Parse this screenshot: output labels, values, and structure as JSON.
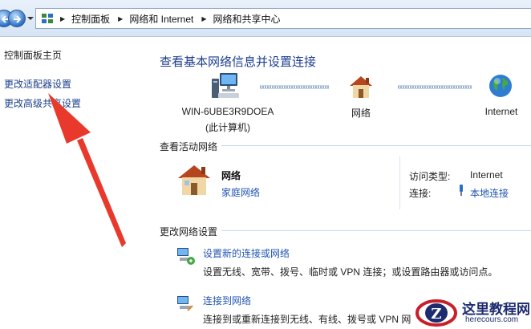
{
  "address_bar": {
    "crumbs": [
      "控制面板",
      "网络和 Internet",
      "网络和共享中心"
    ]
  },
  "left_pane": {
    "home_link": "控制面板主页",
    "adapter_link": "更改适配器设置",
    "advanced_link": "更改高级共享设置"
  },
  "main": {
    "title": "查看基本网络信息并设置连接",
    "map": {
      "computer_name": "WIN-6UBE3R9DOEA",
      "computer_sub": "(此计算机)",
      "network_label": "网络",
      "internet_label": "Internet"
    },
    "active_section": {
      "heading": "查看活动网络",
      "network_name": "网络",
      "network_type": "家庭网络",
      "access_type_label": "访问类型:",
      "access_type_value": "Internet",
      "connection_label": "连接:",
      "connection_value": "本地连接"
    },
    "change_section": {
      "heading": "更改网络设置",
      "tasks": [
        {
          "link": "设置新的连接或网络",
          "desc": "设置无线、宽带、拨号、临时或 VPN 连接；或设置路由器或访问点。"
        },
        {
          "link": "连接到网络",
          "desc": "连接到或重新连接到无线、有线、拨号或 VPN 网"
        }
      ]
    }
  },
  "watermark": {
    "title": "这里教程网",
    "url": "herecours.com"
  },
  "icons": [
    "back-arrow-icon",
    "forward-arrow-icon",
    "control-panel-icon",
    "computer-icon",
    "house-icon",
    "globe-icon",
    "plug-icon",
    "network-setup-icon",
    "connect-network-icon"
  ],
  "colors": {
    "link": "#2154b3",
    "title": "#1e3e8f",
    "annotation_arrow": "#e8392c"
  }
}
